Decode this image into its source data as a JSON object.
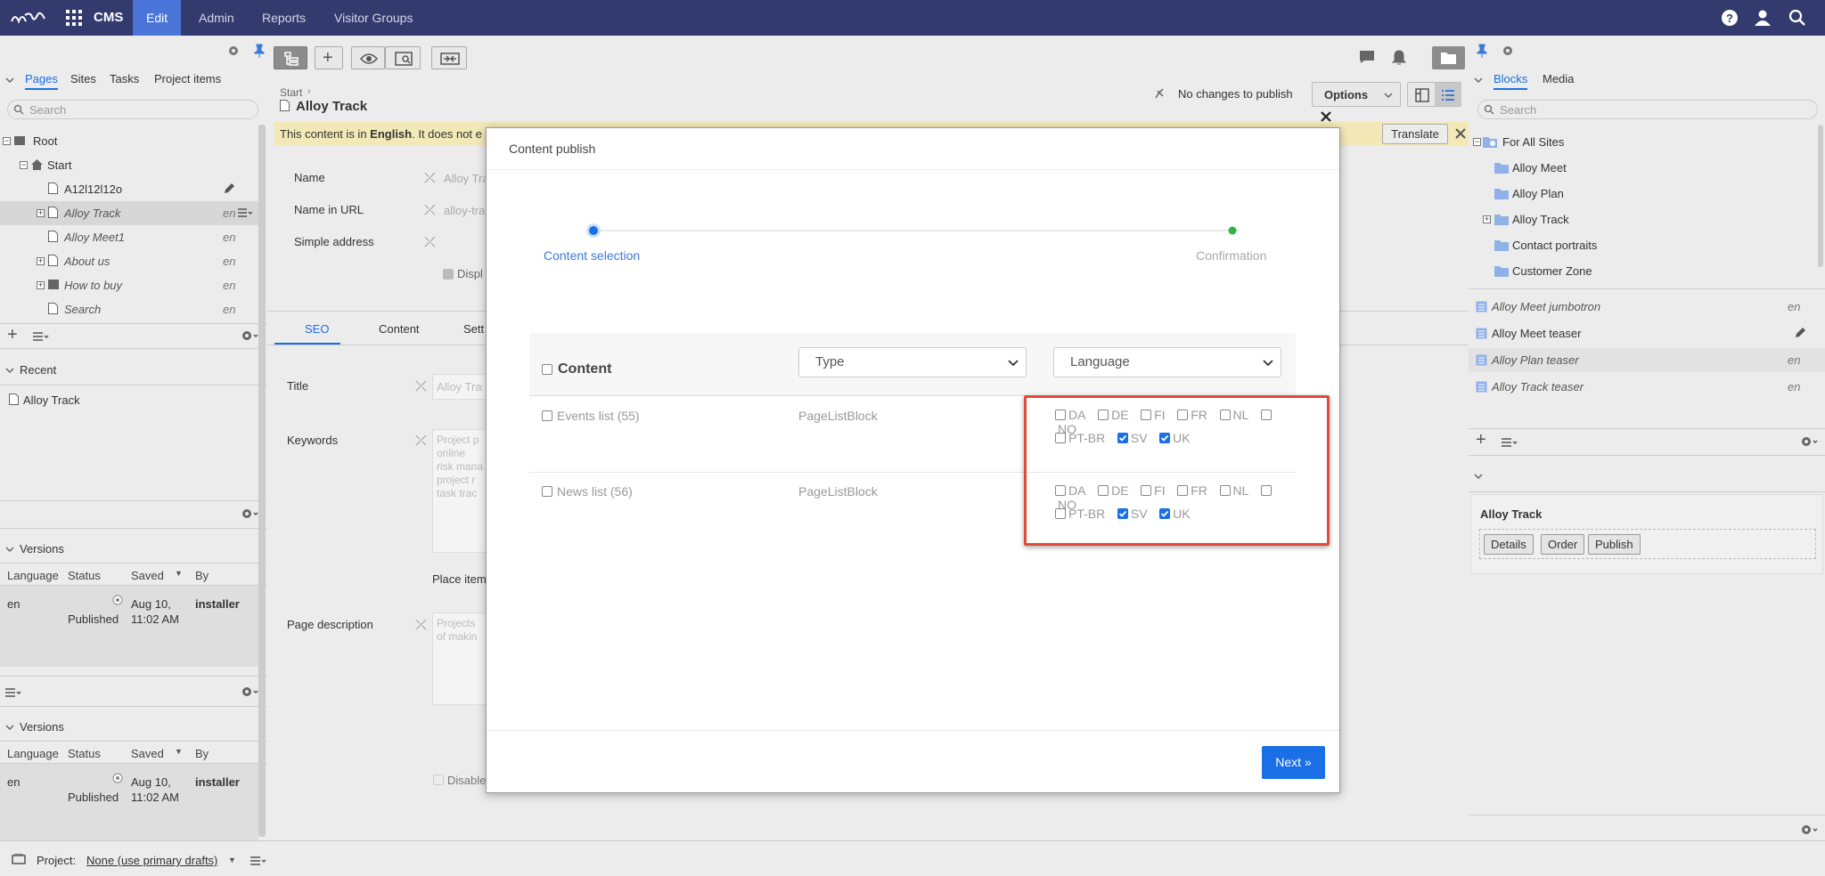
{
  "topbar": {
    "app": "CMS",
    "nav": [
      "Edit",
      "Admin",
      "Reports",
      "Visitor Groups"
    ]
  },
  "left": {
    "tabs": [
      "Pages",
      "Sites",
      "Tasks",
      "Project items"
    ],
    "search_placeholder": "Search",
    "tree": [
      {
        "label": "Root",
        "lang": ""
      },
      {
        "label": "Start",
        "lang": ""
      },
      {
        "label": "A12l12l12o",
        "lang": ""
      },
      {
        "label": "Alloy Track",
        "lang": "en"
      },
      {
        "label": "Alloy Meet1",
        "lang": "en"
      },
      {
        "label": "About us",
        "lang": "en"
      },
      {
        "label": "How to buy",
        "lang": "en"
      },
      {
        "label": "Search",
        "lang": "en"
      }
    ],
    "recent_title": "Recent",
    "recent_items": [
      "Alloy Track"
    ],
    "versions_title": "Versions",
    "versions_cols": [
      "Language",
      "Status",
      "Saved",
      "By"
    ],
    "version_row": {
      "lang": "en",
      "status": "Published",
      "date": "Aug 10,",
      "time": "11:02 AM",
      "by": "installer"
    }
  },
  "center": {
    "breadcrumb": "Start",
    "page_title": "Alloy Track",
    "publish_status": "No changes to publish",
    "options_label": "Options",
    "lang_notice_pre": "This content is in ",
    "lang_notice_lang": "English",
    "lang_notice_post": ". It does not e",
    "translate_label": "Translate",
    "fields": [
      {
        "label": "Name",
        "value": "Alloy Tra"
      },
      {
        "label": "Name in URL",
        "value": "alloy-tra"
      },
      {
        "label": "Simple address",
        "value": ""
      }
    ],
    "display_partial": "Displ",
    "tabs": [
      "SEO",
      "Content",
      "Sett"
    ],
    "seo_fields": {
      "title_label": "Title",
      "title_value": "Alloy Tra",
      "keywords_label": "Keywords",
      "keywords_lines": [
        "Project p",
        "online",
        "risk mana",
        "project r",
        "task trac"
      ],
      "place_items": "Place item",
      "desc_label": "Page description",
      "desc_lines": [
        "Projects",
        "of makin"
      ],
      "disable": "Disable"
    }
  },
  "dialog": {
    "title": "Content publish",
    "step1": "Content selection",
    "step2": "Confirmation",
    "col_content": "Content",
    "type_select": "Type",
    "lang_select": "Language",
    "rows": [
      {
        "name": "Events list (55)",
        "type": "PageListBlock"
      },
      {
        "name": "News list (56)",
        "type": "PageListBlock"
      }
    ],
    "languages": [
      "DA",
      "DE",
      "FI",
      "FR",
      "NL",
      "NO",
      "PT-BR",
      "SV",
      "UK"
    ],
    "checked": [
      "SV",
      "UK"
    ],
    "next_label": "Next »",
    "highlight_color": "#e04a3a"
  },
  "right": {
    "tabs": [
      "Blocks",
      "Media"
    ],
    "search_placeholder": "Search",
    "folders": [
      "For All Sites",
      "Alloy Meet",
      "Alloy Plan",
      "Alloy Track",
      "Contact portraits",
      "Customer Zone"
    ],
    "blocks": [
      {
        "label": "Alloy Meet jumbotron",
        "lang": "en"
      },
      {
        "label": "Alloy Meet teaser",
        "lang": ""
      },
      {
        "label": "Alloy Plan teaser",
        "lang": "en"
      },
      {
        "label": "Alloy Track teaser",
        "lang": "en"
      }
    ],
    "detail_title": "Alloy Track",
    "detail_buttons": [
      "Details",
      "Order",
      "Publish"
    ]
  },
  "bottom": {
    "project_label": "Project:",
    "project_value": "None (use primary drafts)"
  },
  "colors": {
    "topbar": "#333a6e",
    "accent": "#1a6fe6",
    "overlay": "#ececec"
  }
}
